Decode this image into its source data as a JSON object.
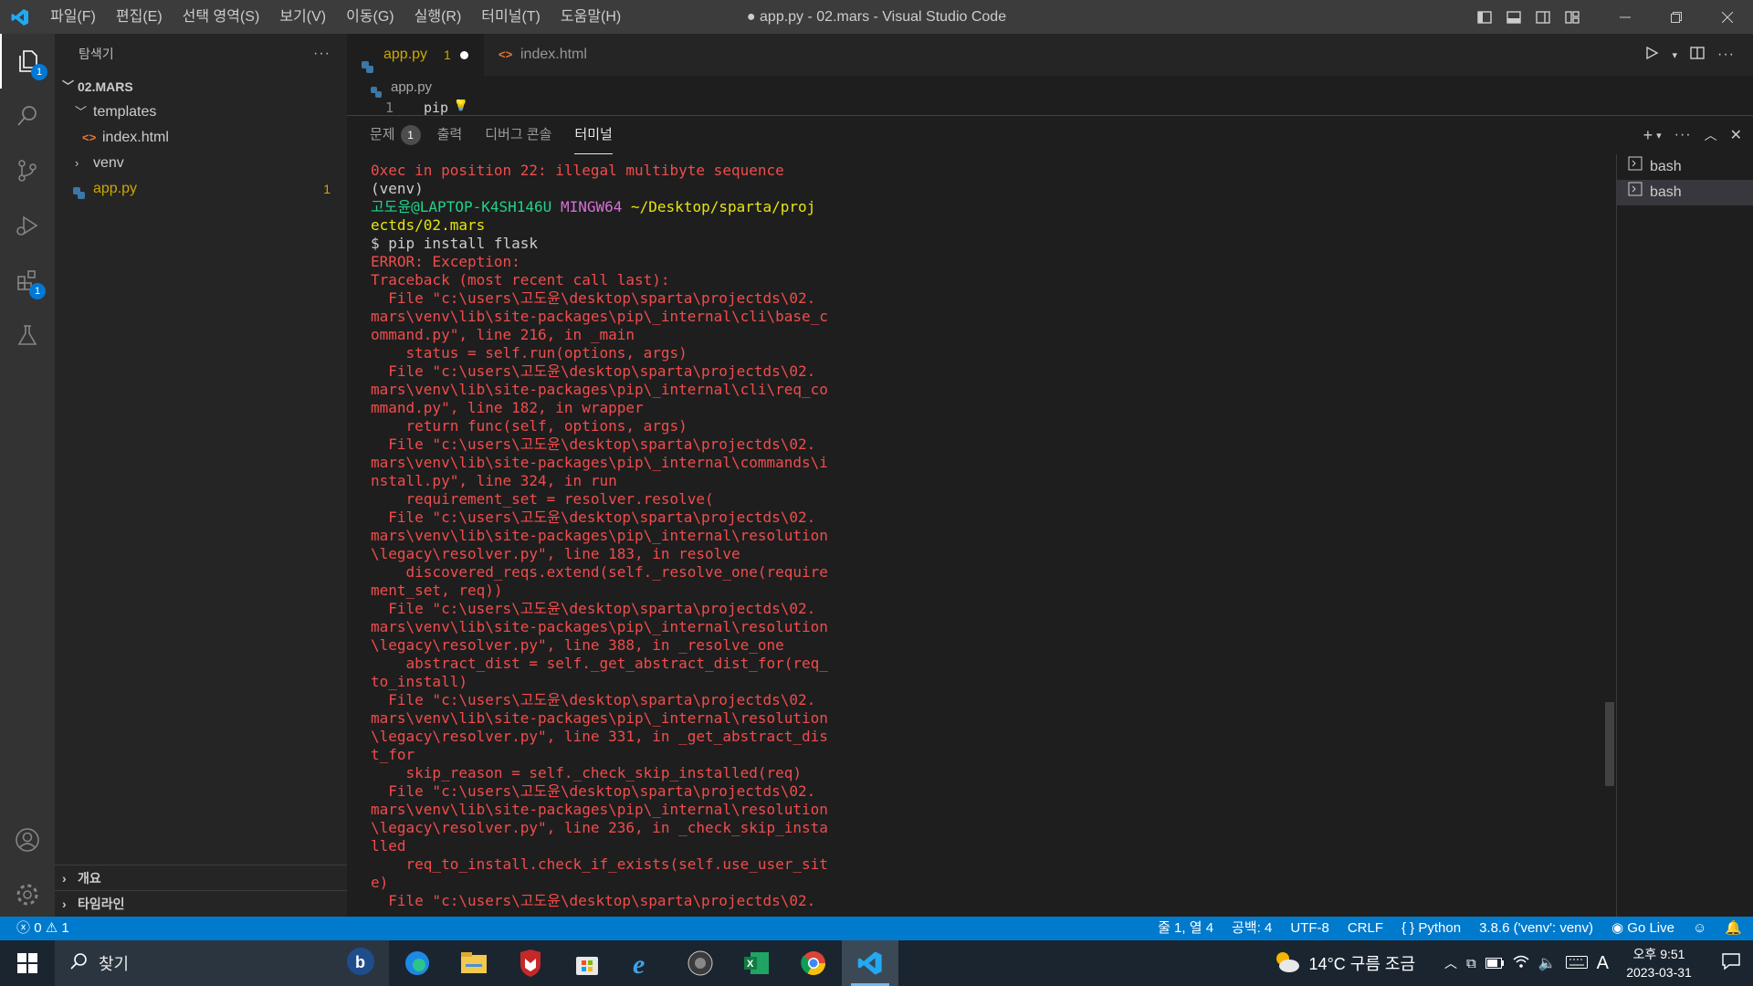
{
  "window": {
    "title": "● app.py - 02.mars - Visual Studio Code",
    "menu": [
      "파일(F)",
      "편집(E)",
      "선택 영역(S)",
      "보기(V)",
      "이동(G)",
      "실행(R)",
      "터미널(T)",
      "도움말(H)"
    ]
  },
  "activity": {
    "explorer_badge": "1",
    "extensions_badge": "1"
  },
  "sidebar": {
    "title": "탐색기",
    "more": "···",
    "root": "02.MARS",
    "items": [
      {
        "label": "templates",
        "kind": "folder-open"
      },
      {
        "label": "index.html",
        "kind": "html"
      },
      {
        "label": "venv",
        "kind": "folder"
      },
      {
        "label": "app.py",
        "kind": "python",
        "badge": "1"
      }
    ],
    "sections": [
      "개요",
      "타임라인"
    ]
  },
  "tabs": [
    {
      "label": "app.py",
      "badge": "1",
      "dirty": true,
      "active": true
    },
    {
      "label": "index.html",
      "active": false
    }
  ],
  "editor": {
    "breadcrumb": "app.py",
    "line_number": "1",
    "line_text": "pip"
  },
  "panel": {
    "tabs": [
      {
        "label": "문제",
        "count": "1"
      },
      {
        "label": "출력"
      },
      {
        "label": "디버그 콘솔"
      },
      {
        "label": "터미널",
        "active": true
      }
    ],
    "terminals": [
      "bash",
      "bash"
    ]
  },
  "terminal_lines": [
    {
      "t": "0xec in position 22: illegal multibyte sequence",
      "c": "err"
    },
    {
      "t": "(venv)",
      "c": "plain"
    },
    {
      "prompt": true,
      "user": "고도윤@LAPTOP-K4SH146U",
      "host": "MINGW64",
      "path": "~/Desktop/sparta/proj"
    },
    {
      "t": "ectds/02.mars",
      "c": "yel"
    },
    {
      "t": "$ pip install flask",
      "c": "plain"
    },
    {
      "t": "ERROR: Exception:",
      "c": "err"
    },
    {
      "t": "Traceback (most recent call last):",
      "c": "err"
    },
    {
      "t": "  File \"c:\\users\\고도윤\\desktop\\sparta\\projectds\\02.",
      "c": "err"
    },
    {
      "t": "mars\\venv\\lib\\site-packages\\pip\\_internal\\cli\\base_c",
      "c": "err"
    },
    {
      "t": "ommand.py\", line 216, in _main",
      "c": "err"
    },
    {
      "t": "    status = self.run(options, args)",
      "c": "err"
    },
    {
      "t": "  File \"c:\\users\\고도윤\\desktop\\sparta\\projectds\\02.",
      "c": "err"
    },
    {
      "t": "mars\\venv\\lib\\site-packages\\pip\\_internal\\cli\\req_co",
      "c": "err"
    },
    {
      "t": "mmand.py\", line 182, in wrapper",
      "c": "err"
    },
    {
      "t": "    return func(self, options, args)",
      "c": "err"
    },
    {
      "t": "  File \"c:\\users\\고도윤\\desktop\\sparta\\projectds\\02.",
      "c": "err"
    },
    {
      "t": "mars\\venv\\lib\\site-packages\\pip\\_internal\\commands\\i",
      "c": "err"
    },
    {
      "t": "nstall.py\", line 324, in run",
      "c": "err"
    },
    {
      "t": "    requirement_set = resolver.resolve(",
      "c": "err"
    },
    {
      "t": "  File \"c:\\users\\고도윤\\desktop\\sparta\\projectds\\02.",
      "c": "err"
    },
    {
      "t": "mars\\venv\\lib\\site-packages\\pip\\_internal\\resolution",
      "c": "err"
    },
    {
      "t": "\\legacy\\resolver.py\", line 183, in resolve",
      "c": "err"
    },
    {
      "t": "    discovered_reqs.extend(self._resolve_one(require",
      "c": "err"
    },
    {
      "t": "ment_set, req))",
      "c": "err"
    },
    {
      "t": "  File \"c:\\users\\고도윤\\desktop\\sparta\\projectds\\02.",
      "c": "err"
    },
    {
      "t": "mars\\venv\\lib\\site-packages\\pip\\_internal\\resolution",
      "c": "err"
    },
    {
      "t": "\\legacy\\resolver.py\", line 388, in _resolve_one",
      "c": "err"
    },
    {
      "t": "    abstract_dist = self._get_abstract_dist_for(req_",
      "c": "err"
    },
    {
      "t": "to_install)",
      "c": "err"
    },
    {
      "t": "  File \"c:\\users\\고도윤\\desktop\\sparta\\projectds\\02.",
      "c": "err"
    },
    {
      "t": "mars\\venv\\lib\\site-packages\\pip\\_internal\\resolution",
      "c": "err"
    },
    {
      "t": "\\legacy\\resolver.py\", line 331, in _get_abstract_dis",
      "c": "err"
    },
    {
      "t": "t_for",
      "c": "err"
    },
    {
      "t": "    skip_reason = self._check_skip_installed(req)",
      "c": "err"
    },
    {
      "t": "  File \"c:\\users\\고도윤\\desktop\\sparta\\projectds\\02.",
      "c": "err"
    },
    {
      "t": "mars\\venv\\lib\\site-packages\\pip\\_internal\\resolution",
      "c": "err"
    },
    {
      "t": "\\legacy\\resolver.py\", line 236, in _check_skip_insta",
      "c": "err"
    },
    {
      "t": "lled",
      "c": "err"
    },
    {
      "t": "    req_to_install.check_if_exists(self.use_user_sit",
      "c": "err"
    },
    {
      "t": "e)",
      "c": "err"
    },
    {
      "t": "  File \"c:\\users\\고도윤\\desktop\\sparta\\projectds\\02.",
      "c": "err"
    }
  ],
  "status": {
    "errors": "0",
    "warnings": "1",
    "position": "줄 1, 열 4",
    "spaces": "공백: 4",
    "encoding": "UTF-8",
    "eol": "CRLF",
    "language": "Python",
    "interpreter": "3.8.6 ('venv': venv)",
    "golive": "Go Live"
  },
  "taskbar": {
    "search_label": "찾기",
    "weather": "14°C  구름 조금",
    "ime": "A",
    "time": "오후 9:51",
    "date": "2023-03-31"
  },
  "colors": {
    "statusbar": "#007acc",
    "accent_badge": "#0078d4",
    "terminal_error": "#f14c4c",
    "modified": "#cca700"
  }
}
